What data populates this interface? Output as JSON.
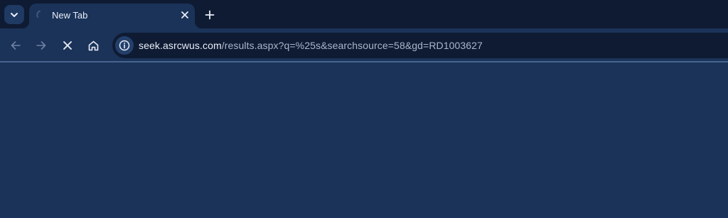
{
  "tabstrip": {
    "search_tabs_icon": "chevron-down-icon",
    "tabs": [
      {
        "title": "New Tab",
        "loading": true,
        "close_icon": "close-icon"
      }
    ],
    "new_tab_icon": "plus-icon"
  },
  "toolbar": {
    "back_icon": "arrow-left-icon",
    "forward_icon": "arrow-right-icon",
    "stop_icon": "close-icon",
    "home_icon": "home-icon",
    "omnibox": {
      "site_info_icon": "info-icon",
      "host": "seek.asrcwus.com",
      "path": "/results.aspx?q=%25s&searchsource=58&gd=RD1003627"
    }
  },
  "colors": {
    "frame": "#0f1b33",
    "toolbar": "#1b3358",
    "text": "#e8eef8",
    "muted_text": "#a9b6c9"
  }
}
